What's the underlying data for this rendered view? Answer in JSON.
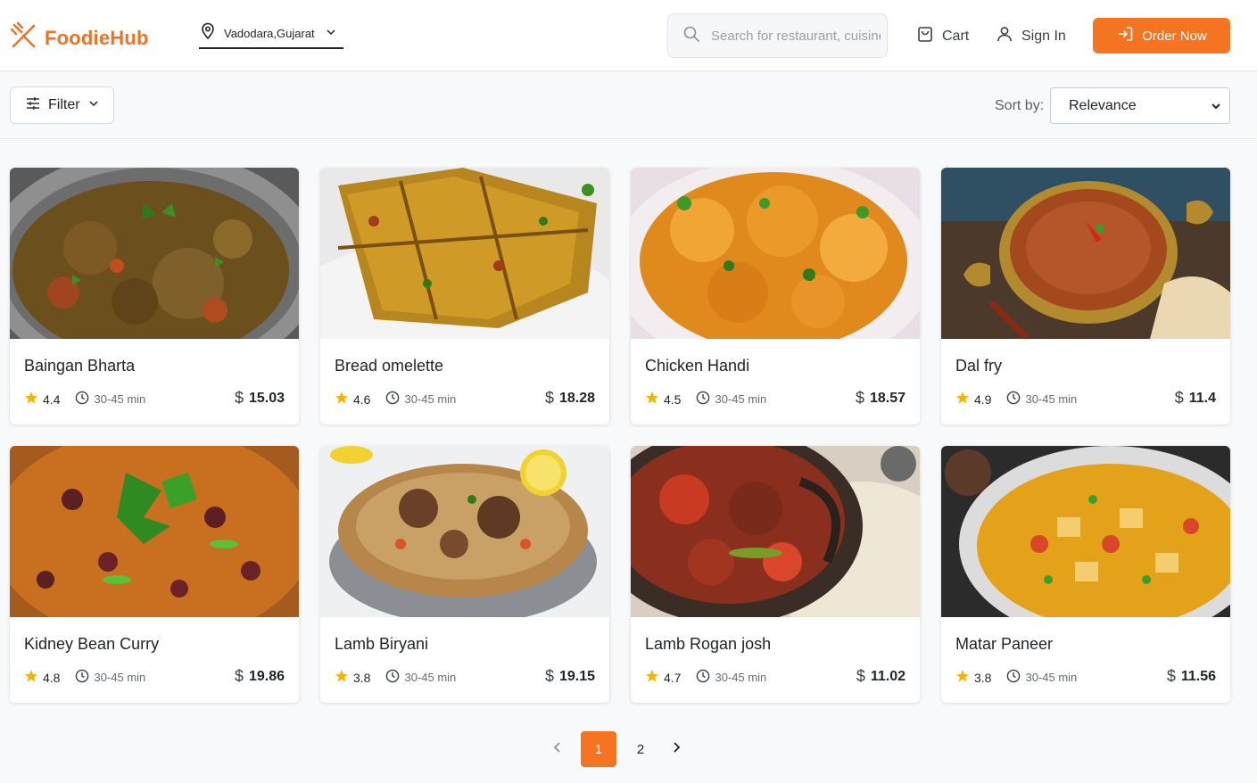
{
  "app": {
    "name": "FoodieHub"
  },
  "header": {
    "location": "Vadodara,Gujarat",
    "search_placeholder": "Search for restaurant, cuisine or a dish",
    "cart_label": "Cart",
    "signin_label": "Sign In",
    "order_label": "Order Now"
  },
  "toolbar": {
    "filter_label": "Filter",
    "sort_label": "Sort by:",
    "sort_value": "Relevance"
  },
  "dishes": [
    {
      "name": "Baingan Bharta",
      "rating": "4.4",
      "time": "30-45 min",
      "price": "$15.03"
    },
    {
      "name": "Bread omelette",
      "rating": "4.6",
      "time": "30-45 min",
      "price": "$18.28"
    },
    {
      "name": "Chicken Handi",
      "rating": "4.5",
      "time": "30-45 min",
      "price": "$18.57"
    },
    {
      "name": "Dal fry",
      "rating": "4.9",
      "time": "30-45 min",
      "price": "$11.4"
    },
    {
      "name": "Kidney Bean Curry",
      "rating": "4.8",
      "time": "30-45 min",
      "price": "$19.86"
    },
    {
      "name": "Lamb Biryani",
      "rating": "3.8",
      "time": "30-45 min",
      "price": "$19.15"
    },
    {
      "name": "Lamb Rogan josh",
      "rating": "4.7",
      "time": "30-45 min",
      "price": "$11.02"
    },
    {
      "name": "Matar Paneer",
      "rating": "3.8",
      "time": "30-45 min",
      "price": "$11.56"
    }
  ],
  "pagination": {
    "pages": [
      "1",
      "2"
    ],
    "current": "1"
  },
  "colors": {
    "accent": "#f47422",
    "star": "#f5b301"
  }
}
